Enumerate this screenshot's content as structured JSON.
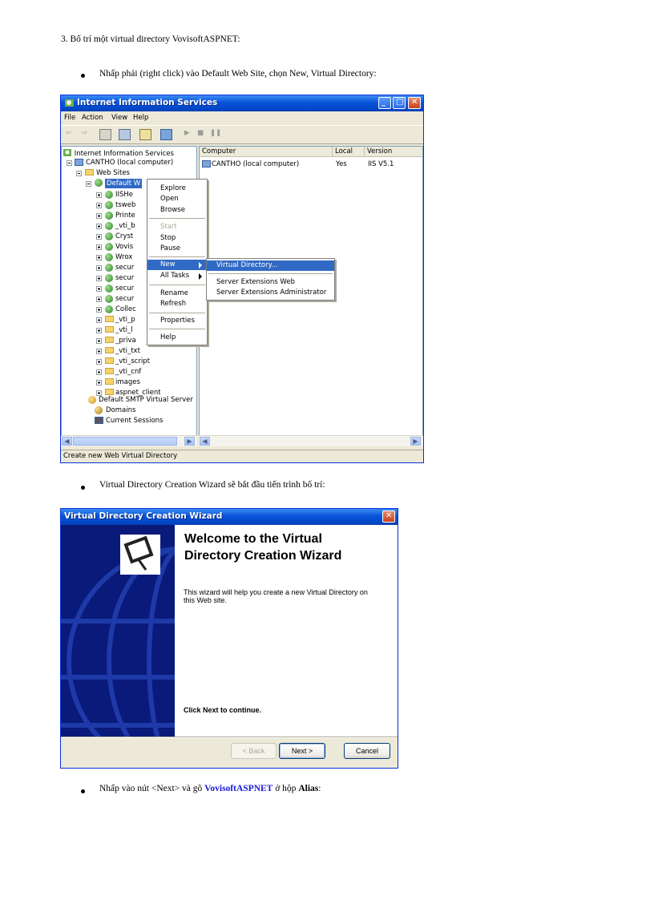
{
  "doc": {
    "heading": "3. Bố trí một virtual directory VovisoftASPNET:",
    "bullet1": "Nhấp phải (right click) vào Default Web Site, chọn New, Virtual Directory:",
    "bullet2": "Virtual Directory Creation Wizard sẽ bắt đầu tiến trình bố trí:",
    "bullet3_pre": "Nhấp vào nút <Next> và gõ ",
    "bullet3_name": "VovisoftASPNET",
    "bullet3_mid": " ở hộp ",
    "bullet3_alias": "Alias",
    "bullet3_end": ":",
    "accent_color": "#1a1ad6"
  },
  "iis": {
    "title": "Internet Information Services",
    "menu": [
      "File",
      "Action",
      "View",
      "Help"
    ],
    "tree": {
      "root": "Internet Information Services",
      "computer": "CANTHO (local computer)",
      "websites": "Web Sites",
      "default_site": "Default W",
      "children": [
        "IISHe",
        "tsweb",
        "Printe",
        "_vti_b",
        "Cryst",
        "Vovis",
        "Wrox",
        "secur",
        "secur",
        "secur",
        "secur",
        "Collec",
        "_vti_p",
        "_vti_l",
        "_priva",
        "_vti_txt",
        "_vti_script",
        "_vti_cnf",
        "images",
        "aspnet_client"
      ],
      "smtp": "Default SMTP Virtual Server",
      "domains": "Domains",
      "sessions": "Current Sessions"
    },
    "columns": [
      "Computer",
      "Local",
      "Version"
    ],
    "row": {
      "computer": "CANTHO (local computer)",
      "local": "Yes",
      "version": "IIS V5.1"
    },
    "context_menu": [
      "Explore",
      "Open",
      "Browse",
      "Start",
      "Stop",
      "Pause",
      "New",
      "All Tasks",
      "Rename",
      "Refresh",
      "Properties",
      "Help"
    ],
    "submenu": [
      "Virtual Directory...",
      "Server Extensions Web",
      "Server Extensions Administrator"
    ],
    "status": "Create new Web Virtual Directory"
  },
  "wizard": {
    "title": "Virtual Directory Creation Wizard",
    "heading_line1": "Welcome to the Virtual",
    "heading_line2": "Directory Creation Wizard",
    "desc_line1": "This wizard will help you create a new Virtual Directory on",
    "desc_line2": "this Web site.",
    "continue": "Click Next to continue.",
    "back": "< Back",
    "next": "Next >",
    "cancel": "Cancel"
  }
}
